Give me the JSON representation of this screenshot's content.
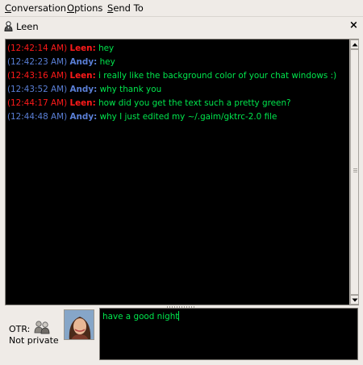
{
  "menubar": {
    "items": [
      {
        "mnemonic": "C",
        "rest": "onversation"
      },
      {
        "mnemonic": "O",
        "rest": "ptions"
      },
      {
        "mnemonic": "S",
        "rest": "end To"
      }
    ]
  },
  "tab": {
    "title": "Leen",
    "close_glyph": "×",
    "icon": "user-icon"
  },
  "colors": {
    "background": "#000000",
    "message_text": "#00e64d",
    "leen": "#ff1a1a",
    "andy": "#5a7fd6"
  },
  "messages": [
    {
      "time": "(12:42:14 AM)",
      "nick": "Leen:",
      "text": "hey",
      "who": "leen"
    },
    {
      "time": "(12:42:23 AM)",
      "nick": "Andy:",
      "text": "hey",
      "who": "andy"
    },
    {
      "time": "(12:43:16 AM)",
      "nick": "Leen:",
      "text": "i really like the background color of your chat windows :)",
      "who": "leen"
    },
    {
      "time": "(12:43:52 AM)",
      "nick": "Andy:",
      "text": "why thank you",
      "who": "andy"
    },
    {
      "time": "(12:44:17 AM)",
      "nick": "Leen:",
      "text": "how did you get the text such a pretty green?",
      "who": "leen"
    },
    {
      "time": "(12:44:48 AM)",
      "nick": "Andy:",
      "text": "why I just edited my ~/.gaim/gktrc-2.0 file",
      "who": "andy"
    }
  ],
  "otr": {
    "label": "OTR:",
    "status": "Not private",
    "icon": "otr-people-icon"
  },
  "entry": {
    "value": "have a good night"
  }
}
